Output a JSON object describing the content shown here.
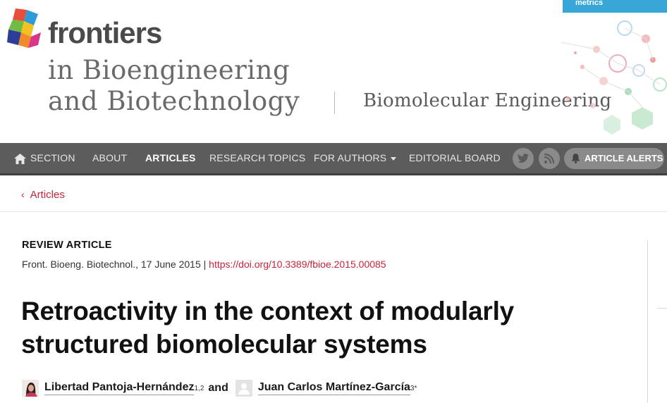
{
  "header": {
    "brand": "frontiers",
    "journal_line1": "in Bioengineering",
    "journal_line2": "and Biotechnology",
    "section": "Biomolecular Engineering",
    "metrics_tab": "metrics"
  },
  "nav": {
    "items": [
      {
        "label": "SECTION",
        "icon": "home-icon"
      },
      {
        "label": "ABOUT"
      },
      {
        "label": "ARTICLES",
        "active": true
      },
      {
        "label": "RESEARCH TOPICS"
      },
      {
        "label": "FOR AUTHORS",
        "dropdown": true
      },
      {
        "label": "EDITORIAL BOARD"
      }
    ],
    "social": [
      "twitter-icon",
      "rss-icon"
    ],
    "alerts_label": "ARTICLE ALERTS"
  },
  "breadcrumb": {
    "label": "Articles"
  },
  "article": {
    "type": "REVIEW ARTICLE",
    "citation_prefix": "Front. Bioeng. Biotechnol., 17 June 2015 | ",
    "doi": "https://doi.org/10.3389/fbioe.2015.00085",
    "title": "Retroactivity in the context of modularly structured biomolecular systems",
    "authors": [
      {
        "name": "Libertad Pantoja-Hernández",
        "aff": "1,2"
      },
      {
        "name": "Juan Carlos Martínez-García",
        "aff": "3*"
      }
    ],
    "authors_joiner": "and"
  },
  "colors": {
    "accent": "#c9233c",
    "nav_bg": "#5c5c5c",
    "metrics_blue": "#39a7d6"
  }
}
